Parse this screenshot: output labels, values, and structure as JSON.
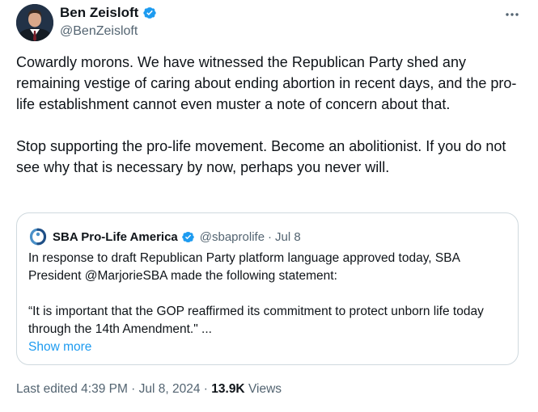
{
  "author": {
    "name": "Ben Zeisloft",
    "handle": "@BenZeisloft",
    "avatar_icon": "person-portrait-icon",
    "verified_color": "#1d9bf0"
  },
  "tweet": {
    "paragraphs": [
      "Cowardly morons. We have witnessed the Republican Party shed any remaining vestige of caring about ending abortion in recent days, and the pro-life establishment cannot even muster a note of concern about that.",
      "Stop supporting the pro-life movement. Become an abolitionist. If you do not see why that is necessary by now, perhaps you never will."
    ]
  },
  "quote": {
    "name": "SBA Pro-Life America",
    "handle": "@sbaprolife",
    "separator": "·",
    "date": "Jul 8",
    "paragraphs": [
      "In response to draft Republican Party platform language approved today, SBA President @MarjorieSBA made the following statement:",
      "“It is important that the GOP reaffirmed its commitment to protect unborn life today through the 14th Amendment.\" ..."
    ],
    "show_more": "Show more"
  },
  "footer": {
    "edited": "Last edited 4:39 PM · Jul 8, 2024 ·",
    "views_count": "13.9K",
    "views_label": "Views"
  },
  "colors": {
    "text": "#0f1419",
    "secondary": "#536471",
    "accent": "#1d9bf0",
    "border": "#cfd9de"
  }
}
